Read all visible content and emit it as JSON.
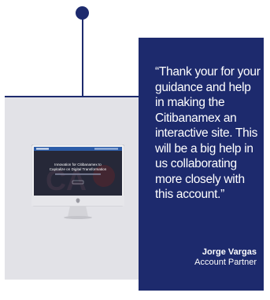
{
  "testimonial": {
    "quote": "“Thank your for your guidance and help in making the Citibanamex an interactive site. This will be a big help in us collaborating more closely with this account.”",
    "author_name": "Jorge Vargas",
    "author_role": "Account Partner"
  },
  "screen": {
    "headline_1": "Innovation for Citibanamex to",
    "headline_2": "Capitalize on Digital Transformation"
  },
  "colors": {
    "navy": "#1d2a6d",
    "panel_bg": "#e2e2e7"
  },
  "icons": {
    "connector": "dot",
    "device": "desktop-monitor",
    "logo": "apple-logo"
  }
}
